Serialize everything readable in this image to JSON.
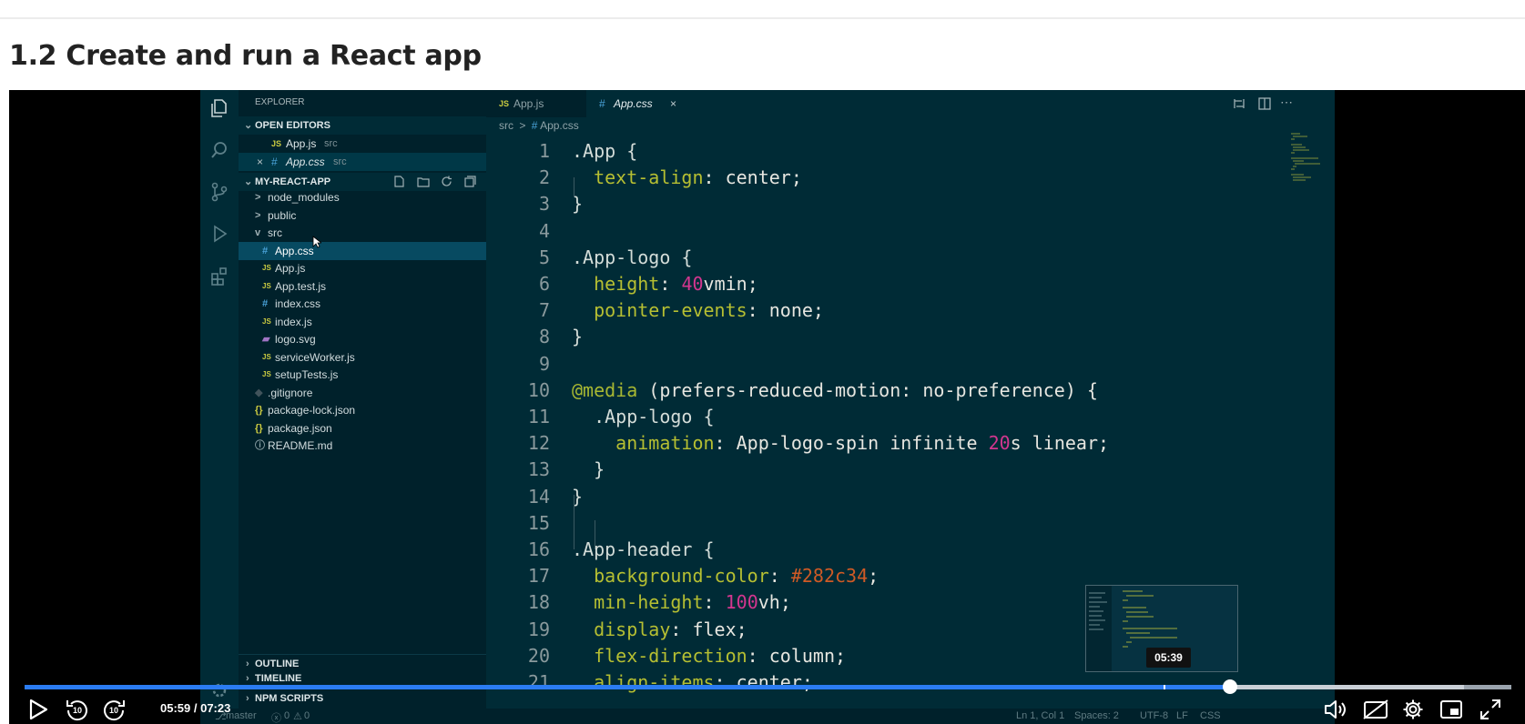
{
  "page": {
    "title": "1.2 Create and run a React app"
  },
  "vscode": {
    "explorer_label": "EXPLORER",
    "open_editors_label": "OPEN EDITORS",
    "open_editors": [
      {
        "badge": "JS",
        "name": "App.js",
        "dir": "src"
      },
      {
        "badge": "#",
        "name": "App.css",
        "dir": "src"
      }
    ],
    "project_label": "MY-REACT-APP",
    "tree": [
      {
        "badge": ">",
        "name": "node_modules"
      },
      {
        "badge": ">",
        "name": "public"
      },
      {
        "badge": "v",
        "name": "src"
      },
      {
        "badge": "#",
        "name": "App.css"
      },
      {
        "badge": "JS",
        "name": "App.js"
      },
      {
        "badge": "JS",
        "name": "App.test.js"
      },
      {
        "badge": "#",
        "name": "index.css"
      },
      {
        "badge": "JS",
        "name": "index.js"
      },
      {
        "badge": "▰",
        "name": "logo.svg"
      },
      {
        "badge": "JS",
        "name": "serviceWorker.js"
      },
      {
        "badge": "JS",
        "name": "setupTests.js"
      },
      {
        "badge": "◆",
        "name": ".gitignore"
      },
      {
        "badge": "{}",
        "name": "package-lock.json"
      },
      {
        "badge": "{}",
        "name": "package.json"
      },
      {
        "badge": "ⓘ",
        "name": "README.md"
      }
    ],
    "outline_label": "OUTLINE",
    "timeline_label": "TIMELINE",
    "npm_label": "NPM SCRIPTS",
    "tabs": [
      {
        "badge": "JS",
        "name": "App.js"
      },
      {
        "badge": "#",
        "name": "App.css",
        "close": "×"
      }
    ],
    "breadcrumb": {
      "folder": "src",
      "sep": ">",
      "badge": "#",
      "file": "App.css"
    },
    "code_lines": [
      {
        "n": "1",
        "text": ".App {"
      },
      {
        "n": "2",
        "text": "  text-align: center;"
      },
      {
        "n": "3",
        "text": "}"
      },
      {
        "n": "4",
        "text": ""
      },
      {
        "n": "5",
        "text": ".App-logo {"
      },
      {
        "n": "6",
        "text": "  height: 40vmin;"
      },
      {
        "n": "7",
        "text": "  pointer-events: none;"
      },
      {
        "n": "8",
        "text": "}"
      },
      {
        "n": "9",
        "text": ""
      },
      {
        "n": "10",
        "text": "@media (prefers-reduced-motion: no-preference) {"
      },
      {
        "n": "11",
        "text": "  .App-logo {"
      },
      {
        "n": "12",
        "text": "    animation: App-logo-spin infinite 20s linear;"
      },
      {
        "n": "13",
        "text": "  }"
      },
      {
        "n": "14",
        "text": "}"
      },
      {
        "n": "15",
        "text": ""
      },
      {
        "n": "16",
        "text": ".App-header {"
      },
      {
        "n": "17",
        "text": "  background-color: #282c34;"
      },
      {
        "n": "18",
        "text": "  min-height: 100vh;"
      },
      {
        "n": "19",
        "text": "  display: flex;"
      },
      {
        "n": "20",
        "text": "  flex-direction: column;"
      },
      {
        "n": "21",
        "text": "  align-items: center;"
      }
    ],
    "status": {
      "branch": "master",
      "problems": "0",
      "warnings": "0",
      "position": "Ln 1, Col 1",
      "spaces": "Spaces: 2",
      "encoding": "UTF-8",
      "eol": "LF",
      "language": "CSS"
    }
  },
  "video": {
    "current_time": "05:59",
    "duration": "07:23",
    "time_display": "05:59 / 07:23",
    "hover_time": "05:39",
    "progress_fraction": 0.811,
    "hover_fraction": 0.7665,
    "buffered_fraction": 0.968
  },
  "colors": {
    "accent": "#2b7cf2",
    "editor_bg": "#002b36",
    "sidebar_bg": "#00212b",
    "selection": "#074a61"
  }
}
